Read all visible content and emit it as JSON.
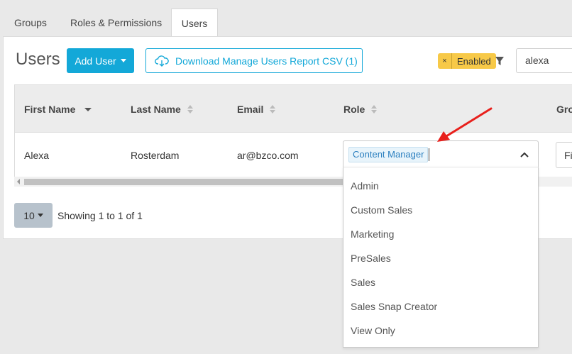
{
  "tabs": [
    {
      "label": "Groups"
    },
    {
      "label": "Roles & Permissions"
    },
    {
      "label": "Users"
    }
  ],
  "header": {
    "title": "Users",
    "add_user_label": "Add User",
    "download_label": "Download Manage Users Report CSV (1)",
    "filter_badge_close": "×",
    "filter_badge_label": "Enabled",
    "search_value": "alexa"
  },
  "table": {
    "columns": [
      "First Name",
      "Last Name",
      "Email",
      "Role",
      "Gro"
    ],
    "row": {
      "first_name": "Alexa",
      "last_name": "Rosterdam",
      "email": "ar@bzco.com",
      "groups_value": "Fi"
    }
  },
  "pager": {
    "page_size": "10",
    "showing": "Showing 1 to 1 of 1"
  },
  "role_select": {
    "selected_tag": "Content Manager",
    "options": [
      "Admin",
      "Custom Sales",
      "Marketing",
      "PreSales",
      "Sales",
      "Sales Snap Creator",
      "View Only"
    ]
  },
  "colors": {
    "accent": "#13a8d8",
    "badge": "#f7c948",
    "arrow": "#e8201c"
  },
  "icons": {
    "download": "cloud-download-icon",
    "filter": "filter-icon",
    "chevron": "chevron-up-icon"
  }
}
